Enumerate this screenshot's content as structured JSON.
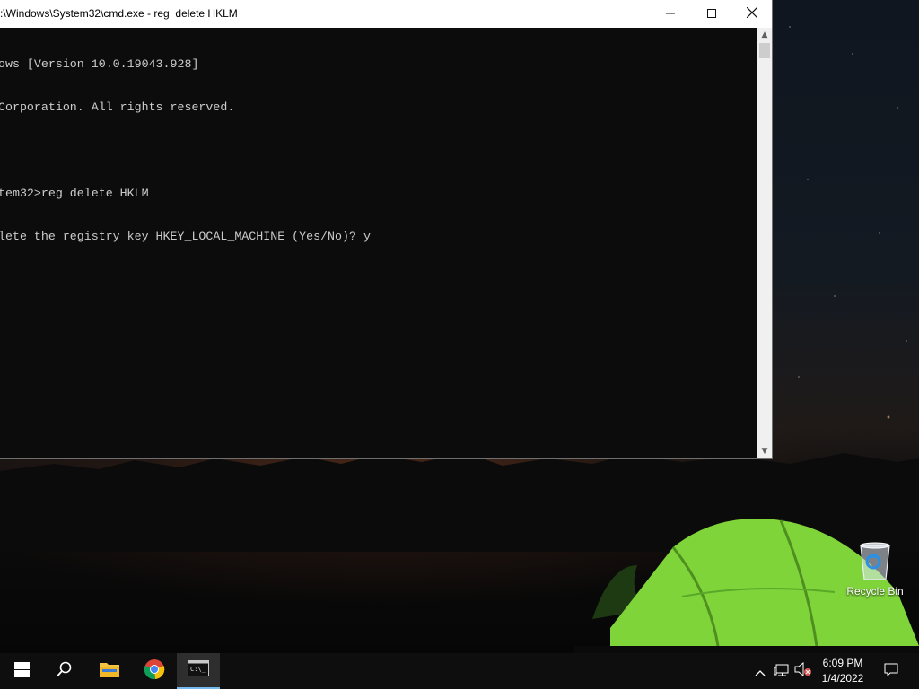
{
  "window": {
    "title": ":\\Windows\\System32\\cmd.exe - reg  delete HKLM",
    "minimize_icon": "minimize-icon",
    "maximize_icon": "maximize-icon",
    "close_icon": "close-icon"
  },
  "console": {
    "lines": [
      "ows [Version 10.0.19043.928]",
      "Corporation. All rights reserved.",
      "",
      "tem32>reg delete HKLM",
      "lete the registry key HKEY_LOCAL_MACHINE (Yes/No)? y"
    ]
  },
  "desktop": {
    "icons": [
      {
        "label": "Recycle Bin",
        "icon": "recycle-bin-icon"
      }
    ]
  },
  "taskbar": {
    "items": [
      {
        "name": "start",
        "icon": "windows-icon"
      },
      {
        "name": "search",
        "icon": "search-icon"
      },
      {
        "name": "file-explorer",
        "icon": "folder-icon"
      },
      {
        "name": "chrome",
        "icon": "chrome-icon"
      },
      {
        "name": "cmd",
        "icon": "terminal-icon",
        "active": true
      }
    ],
    "tray": {
      "icons": [
        "chevron-up-icon",
        "network-icon",
        "volume-muted-icon"
      ],
      "time": "6:09 PM",
      "date": "1/4/2022",
      "notification_icon": "notification-icon"
    }
  }
}
